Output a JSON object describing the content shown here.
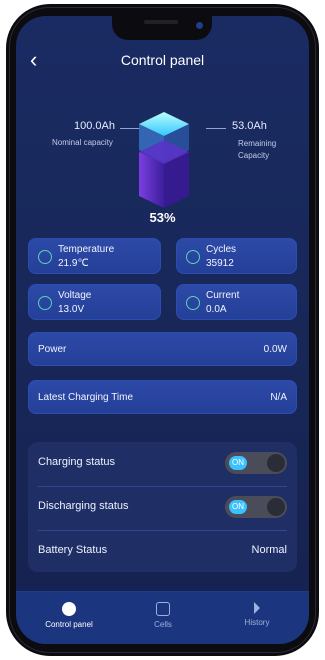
{
  "header": {
    "title": "Control panel"
  },
  "capacity": {
    "nominal_value": "100.0Ah",
    "nominal_label": "Nominal capacity",
    "remaining_value": "53.0Ah",
    "remaining_label": "Remaining Capacity",
    "percent": "53%",
    "percent_value": 53
  },
  "stats": {
    "temperature": {
      "label": "Temperature",
      "value": "21.9℃"
    },
    "cycles": {
      "label": "Cycles",
      "value": "35912"
    },
    "voltage": {
      "label": "Voltage",
      "value": "13.0V"
    },
    "current": {
      "label": "Current",
      "value": "0.0A"
    }
  },
  "rows": {
    "power": {
      "label": "Power",
      "value": "0.0W"
    },
    "charging_time": {
      "label": "Latest Charging Time",
      "value": "N/A"
    }
  },
  "status": {
    "charging": {
      "label": "Charging status",
      "toggle_text": "ON"
    },
    "discharging": {
      "label": "Discharging status",
      "toggle_text": "ON"
    },
    "battery": {
      "label": "Battery Status",
      "value": "Normal"
    }
  },
  "tabs": [
    {
      "label": "Control panel"
    },
    {
      "label": "Cells"
    },
    {
      "label": "History"
    }
  ],
  "colors": {
    "accent": "#3cc1ff",
    "card": "#2b47a3",
    "background": "#1a2b63"
  },
  "icons": {
    "back": "chevron-left-icon",
    "temperature": "thermometer-icon",
    "cycles": "cycle-icon",
    "voltage": "voltage-icon",
    "current": "current-icon",
    "tab_control": "control-panel-icon",
    "tab_cells": "cells-icon",
    "tab_history": "history-icon"
  }
}
